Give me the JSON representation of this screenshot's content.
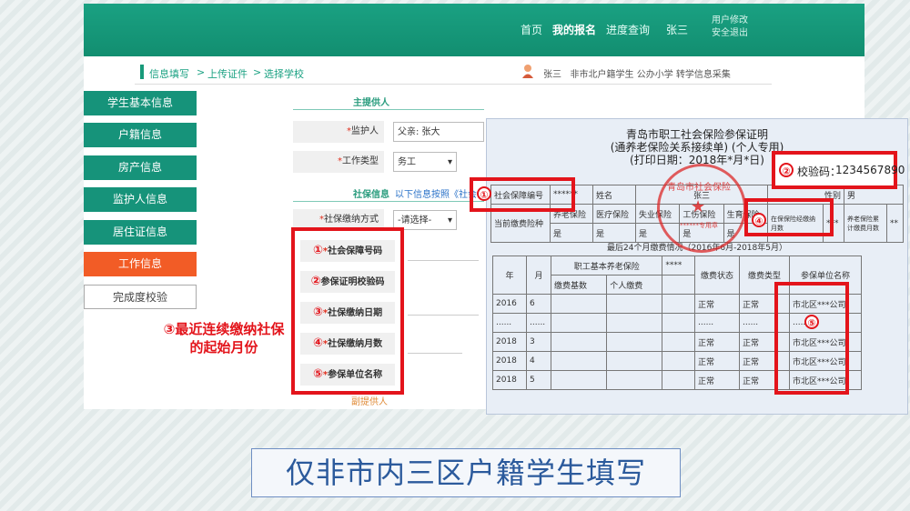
{
  "nav": {
    "home": "首页",
    "my_registration": "我的报名",
    "progress": "进度查询",
    "user_name": "张三",
    "user_edit": "用户修改",
    "safe_exit": "安全退出"
  },
  "breadcrumb": [
    "信息填写",
    "上传证件",
    "选择学校"
  ],
  "breadcrumb_sep": ">",
  "user_info": {
    "name": "张三",
    "desc": "非市北户籍学生 公办小学 转学信息采集"
  },
  "sidebar": {
    "items": [
      {
        "label": "学生基本信息"
      },
      {
        "label": "户籍信息"
      },
      {
        "label": "房产信息"
      },
      {
        "label": "监护人信息"
      },
      {
        "label": "居住证信息"
      },
      {
        "label": "工作信息"
      },
      {
        "label": "完成度校验"
      }
    ]
  },
  "form": {
    "main_provider": "主提供人",
    "guardian_label": "监护人",
    "guardian_value": "父亲: 张大",
    "work_type_label": "工作类型",
    "work_type_value": "务工",
    "social_section": "社保信息",
    "social_note": "以下信息按照《社会",
    "payment_method_label": "社保缴纳方式",
    "payment_method_value": "-请选择-",
    "secondary_provider": "副提供人"
  },
  "fields": [
    {
      "num": "①",
      "label": "社会保障号码",
      "required": true
    },
    {
      "num": "②",
      "label": "参保证明校验码",
      "required": false
    },
    {
      "num": "③",
      "label": "社保缴纳日期",
      "required": true
    },
    {
      "num": "④",
      "label": "社保缴纳月数",
      "required": true
    },
    {
      "num": "⑤",
      "label": "参保单位名称",
      "required": true
    }
  ],
  "required_mark": "*",
  "callout3": {
    "num": "③",
    "text": "最近连续缴纳社保的起始月份"
  },
  "certificate": {
    "title1": "青岛市职工社会保险参保证明",
    "title2": "(通养老保险关系接续单)  (个人专用)",
    "title3": "(打印日期：2018年*月*日)",
    "verify_num": "②",
    "verify_label": "校验码：",
    "verify_value": "1234567890",
    "row1": [
      "社会保障编号",
      "******",
      "姓名",
      "张三",
      "性别",
      "男"
    ],
    "row2": [
      "当前缴费险种",
      "养老保险",
      "医疗保险",
      "失业保险",
      "工伤保险",
      "生育保险",
      "在保保险经缴纳月数",
      "***",
      "养老保险累计缴费月数",
      "**"
    ],
    "row2b": [
      "是",
      "是",
      "是",
      "是",
      "是"
    ],
    "recent_caption": "最后24个月缴费情况（2016年6月-2018年5月）",
    "headers": [
      "年",
      "月",
      "职工基本养老保险",
      "****",
      "缴费状态",
      "缴费类型",
      "参保单位名称"
    ],
    "subheaders": [
      "缴费基数",
      "个人缴费"
    ],
    "rows": [
      [
        "2016",
        "6",
        "正常",
        "正常",
        "市北区***公司"
      ],
      [
        "......",
        "......",
        "......",
        "......",
        "......"
      ],
      [
        "2018",
        "3",
        "正常",
        "正常",
        "市北区***公司"
      ],
      [
        "2018",
        "4",
        "正常",
        "正常",
        "市北区***公司"
      ],
      [
        "2018",
        "5",
        "正常",
        "正常",
        "市北区***公司"
      ]
    ],
    "stamp_text": "青岛市社会保险",
    "stamp_sub": "******专用章",
    "markers": [
      "①",
      "④",
      "⑤"
    ]
  },
  "banner": "仅非市内三区户籍学生填写",
  "colors": {
    "brand": "#1aa182",
    "menu": "#16937a",
    "active_menu": "#f25c26",
    "highlight": "#e3141b"
  }
}
